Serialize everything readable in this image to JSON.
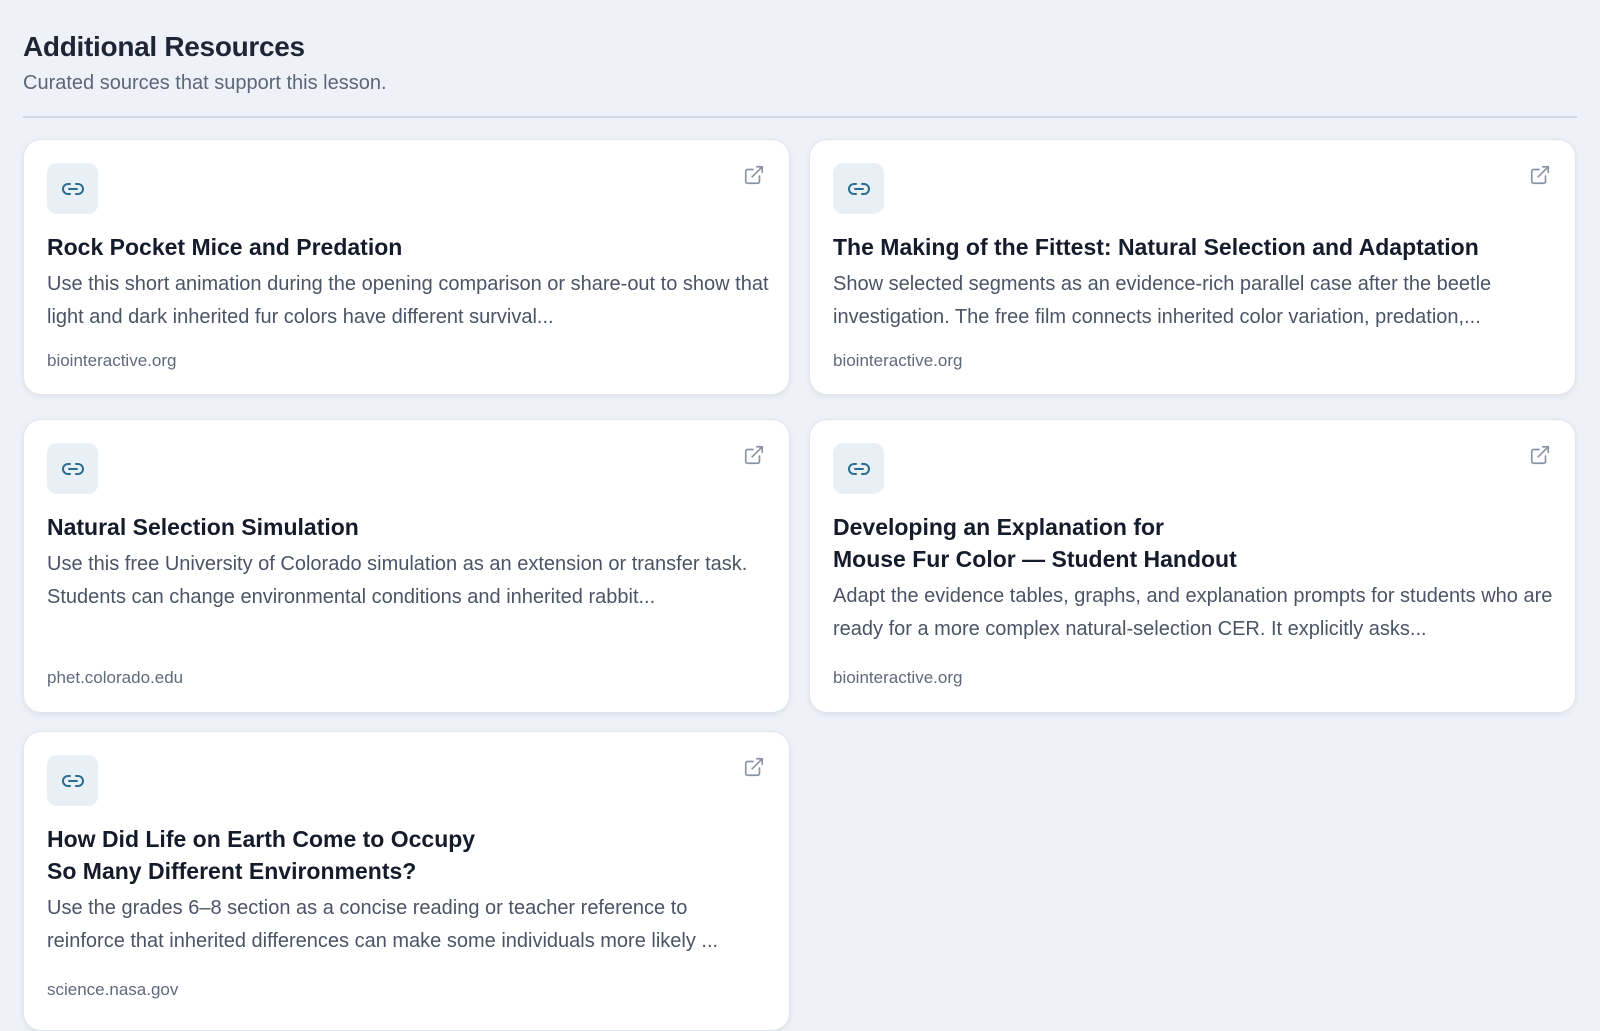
{
  "header": {
    "title": "Additional Resources",
    "subtitle": "Curated sources that support this lesson."
  },
  "colors": {
    "background": "#eef2f8",
    "card": "#ffffff",
    "icon_tile": "#e8f0f5",
    "link_icon": "#2c6e8f",
    "external_icon": "#8a93a3"
  },
  "resources": [
    {
      "icon": "link-icon",
      "title": "Rock Pocket Mice and Predation",
      "description": "Use this short animation during the opening comparison or share-out to show that light and dark inherited fur colors have different survival...",
      "domain": "biointeractive.org",
      "action_icon": "external-link-icon"
    },
    {
      "icon": "link-icon",
      "title": "The Making of the Fittest: Natural Selection and Adaptation",
      "description": "Show selected segments as an evidence-rich parallel case after the beetle investigation. The free film connects inherited color variation, predation,...",
      "domain": "biointeractive.org",
      "action_icon": "external-link-icon"
    },
    {
      "icon": "link-icon",
      "title": "Natural Selection Simulation",
      "description": "Use this free University of Colorado simulation as an extension or transfer task. Students can change environmental conditions and inherited rabbit...",
      "domain": "phet.colorado.edu",
      "action_icon": "external-link-icon"
    },
    {
      "icon": "link-icon",
      "title": "Developing an Explanation for\nMouse Fur Color — Student Handout",
      "description": "Adapt the evidence tables, graphs, and explanation prompts for students who are ready for a more complex natural-selection CER. It explicitly asks...",
      "domain": "biointeractive.org",
      "action_icon": "external-link-icon"
    },
    {
      "icon": "link-icon",
      "title": "How Did Life on Earth Come to Occupy\nSo Many Different Environments?",
      "description": "Use the grades 6–8 section as a concise reading or teacher reference to reinforce that inherited differences can make some individuals more likely ...",
      "domain": "science.nasa.gov",
      "action_icon": "external-link-icon"
    }
  ]
}
